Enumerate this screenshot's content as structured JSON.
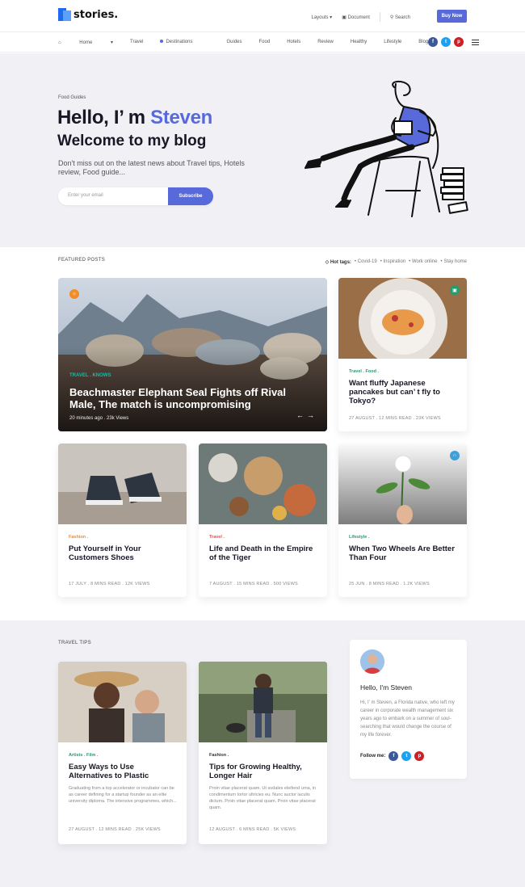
{
  "header": {
    "logo": "stories.",
    "links": [
      "Layouts",
      "Document",
      "Search"
    ],
    "buy_label": "Buy Now"
  },
  "nav": {
    "items": [
      "Home",
      "Travel",
      "Destinations",
      "Guides",
      "Food",
      "Hotels",
      "Review",
      "Healthy",
      "Lifestyle",
      "Blog"
    ]
  },
  "hero": {
    "category": "Food Guides",
    "greeting": "Hello, I’ m ",
    "name": "Steven",
    "subtitle": "Welcome to my blog",
    "description": "Don't miss out on the latest news about Travel tips, Hotels review, Food guide...",
    "email_placeholder": "Enter your email",
    "subscribe_label": "Subscribe"
  },
  "featured": {
    "section_title": "FEATURED POSTS",
    "hot_tags_label": "Hot tags:",
    "hot_tags": [
      "Covid-19",
      "Inspiration",
      "Work online",
      "Stay home"
    ],
    "big": {
      "cats": "TRAVEL  .  KNOWS",
      "title": "Beachmaster Elephant Seal Fights off Rival Male, The match is uncompromising",
      "meta": "20 minutes ago  .  23k Views"
    },
    "side": {
      "cats": "Travel . Food .",
      "title": "Want fluffy Japanese pancakes but can’ t fly to Tokyo?",
      "meta": "27 AUGUST  .  12 MINS READ  .  23K VIEWS"
    },
    "row": [
      {
        "cat": "Fashion .",
        "title": "Put Yourself in Your Customers Shoes",
        "meta": "17 JULY  .  8 MINS READ  .  12K VIEWS",
        "cat_color": "#f28c28"
      },
      {
        "cat": "Travel .",
        "title": "Life and Death in the Empire of the Tiger",
        "meta": "7 AUGUST  .  15 MINS READ  .  500 VIEWS",
        "cat_color": "#e8504f"
      },
      {
        "cat": "Lifestyle .",
        "title": "When Two Wheels Are Better Than Four",
        "meta": "25 JUN  .  8 MINS READ  .  1.2K VIEWS",
        "cat_color": "#1f9e6e"
      }
    ]
  },
  "tips": {
    "section_title": "TRAVEL TIPS",
    "cards": [
      {
        "cat": "Artists .  Film .",
        "title": "Easy Ways to Use Alternatives to Plastic",
        "excerpt": "Graduating from a top accelerator or incubator can be as career defining for a startup founder as an elite university diploma. The intensive programmes, which...",
        "meta": "27 AUGUST  .  12 MINS READ  .  25K VIEWS"
      },
      {
        "cat": "Fashion .",
        "title": "Tips for Growing Healthy, Longer Hair",
        "excerpt": "Proin vitae placerat quam. Ut sodales eleifend urna, in condimentum tortor ultricies eu. Nunc auctor iaculis dictum. Proin vitae placerat quam. Proin vitae placerat quam.",
        "meta": "12 AUGUST  .  6 MINS READ  .  5K VIEWS"
      }
    ],
    "author": {
      "hello": "Hello, I'm Steven",
      "bio": "Hi, I’ m Steven, a Florida native, who left my career in corporate wealth management six years ago to embark on a summer of soul-searching that would change the course of my life forever.",
      "follow": "Follow me:"
    }
  }
}
